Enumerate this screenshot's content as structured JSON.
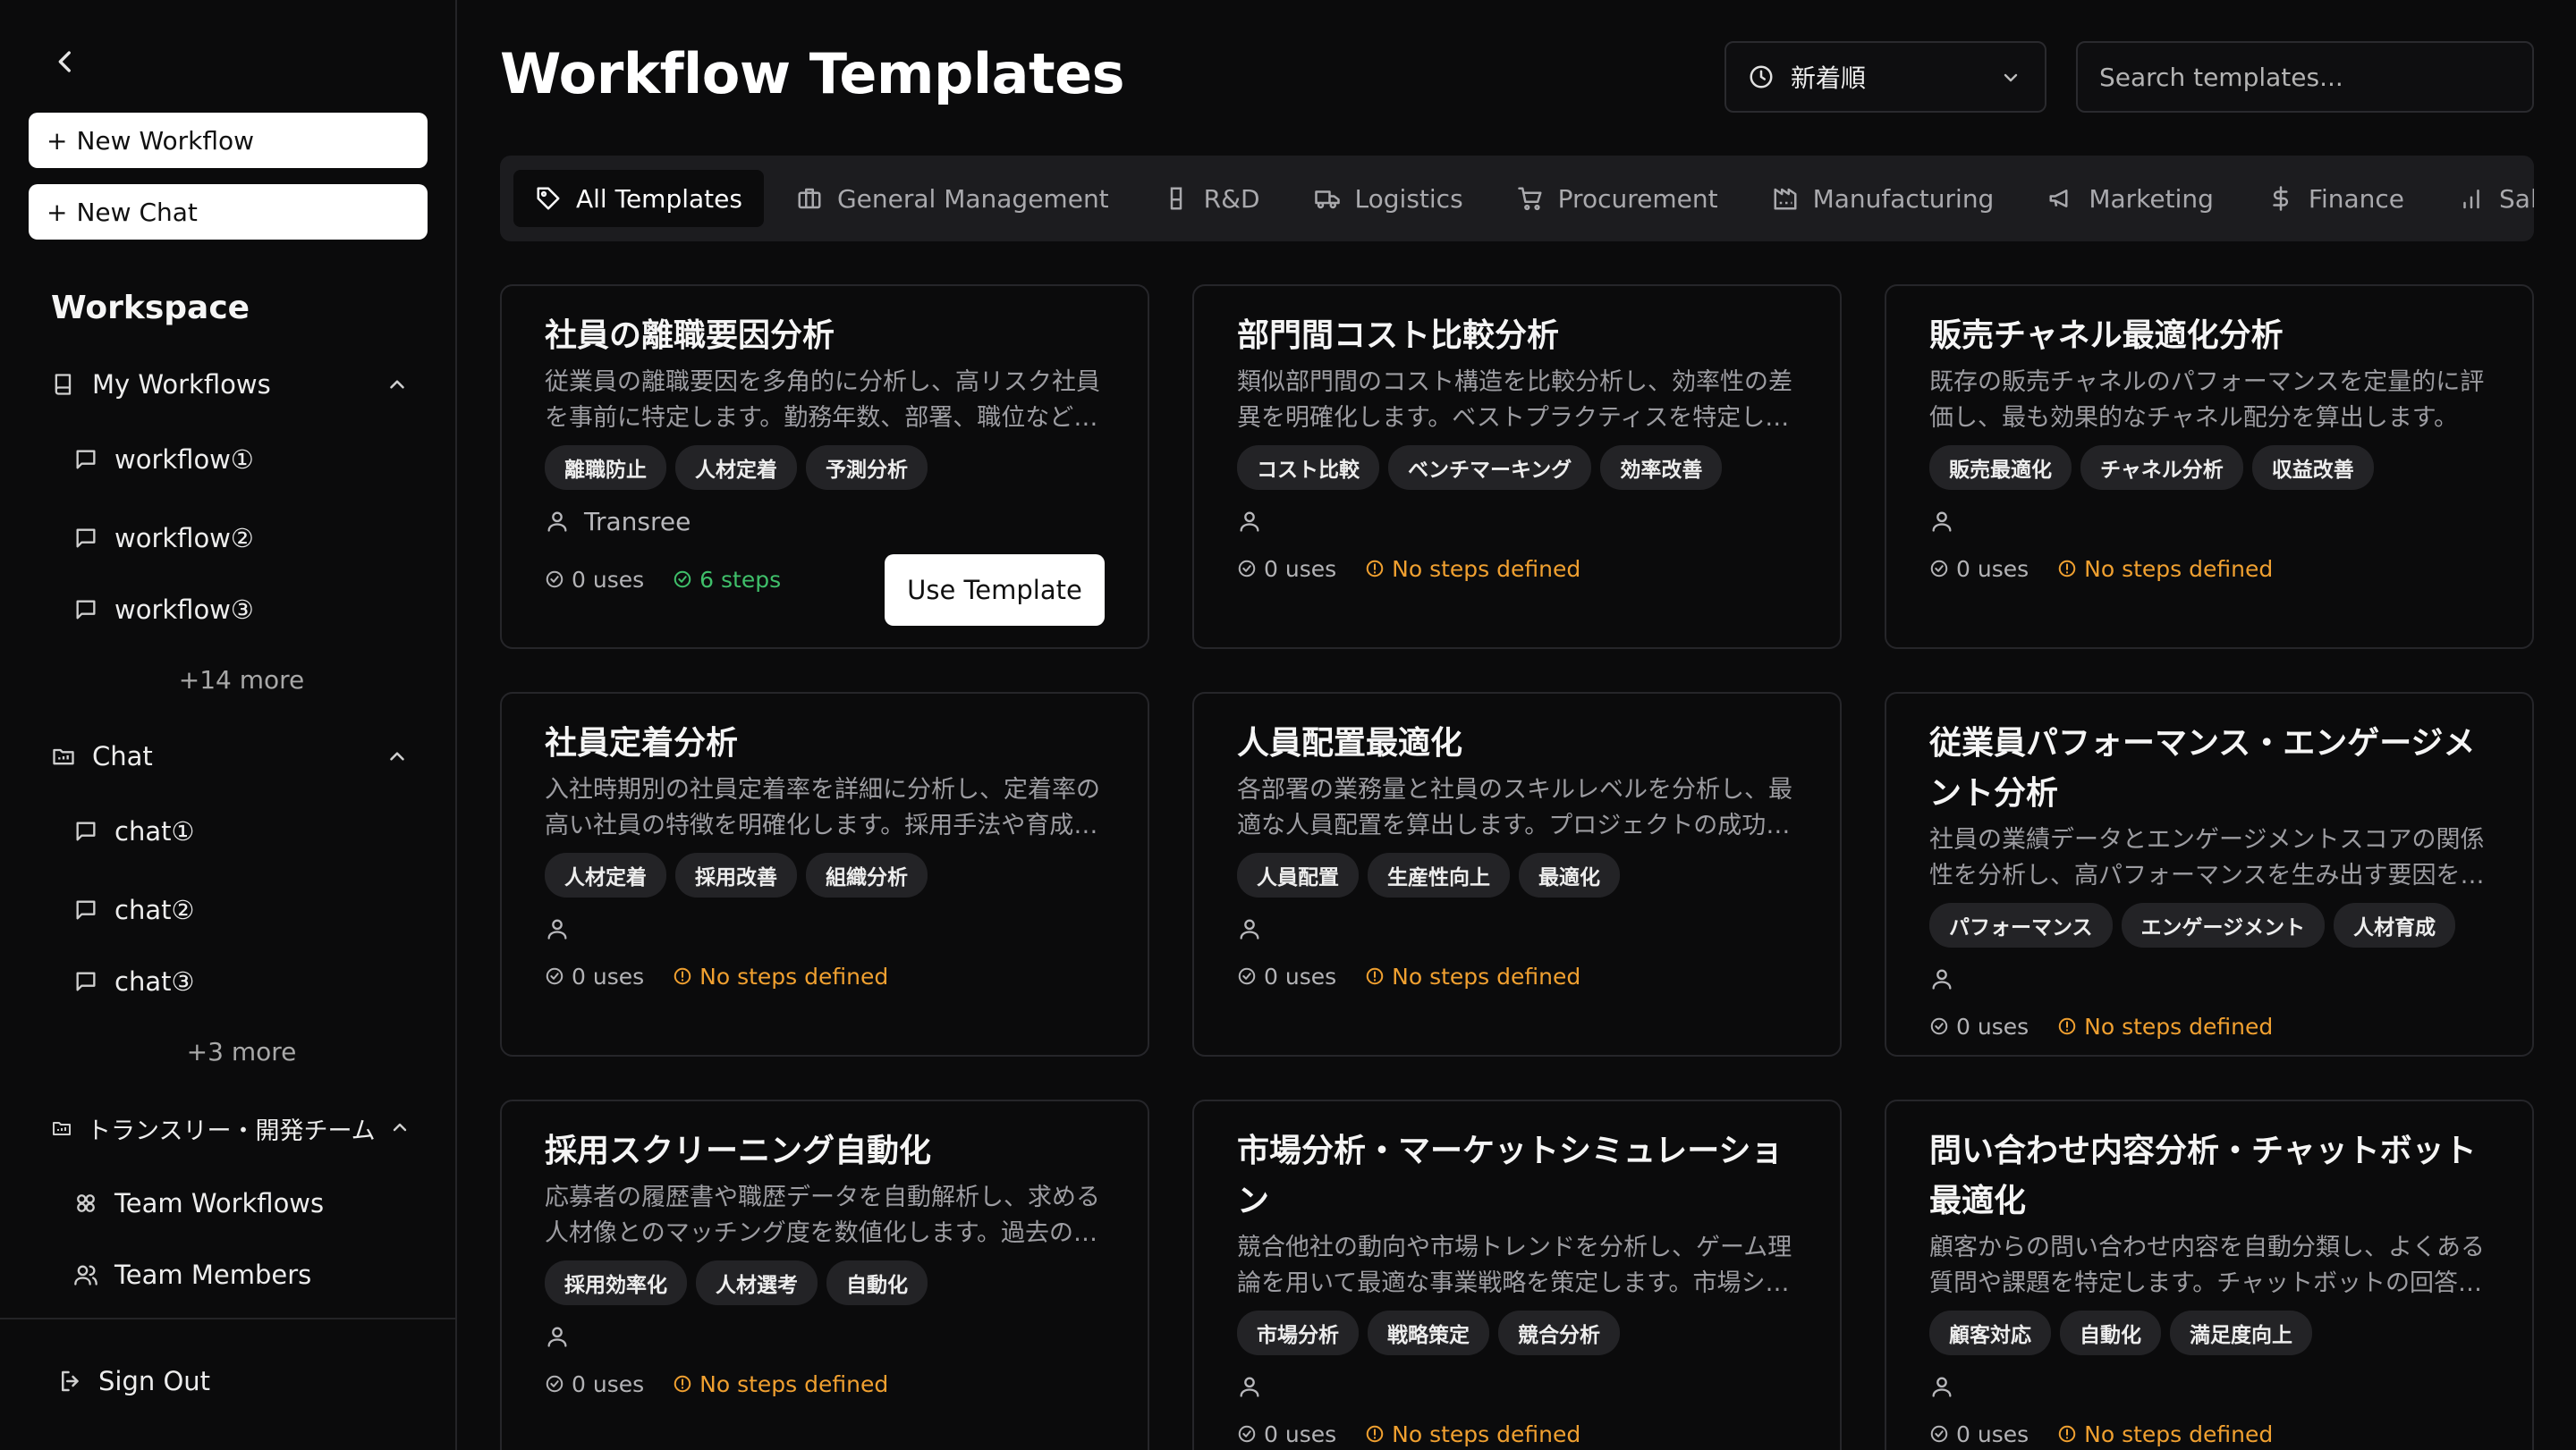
{
  "sidebar": {
    "new_workflow": "New Workflow",
    "new_chat": "New Chat",
    "workspace_title": "Workspace",
    "my_workflows": {
      "label": "My Workflows",
      "items": [
        "workflow①",
        "workflow②",
        "workflow③"
      ],
      "more": "+14 more"
    },
    "chat": {
      "label": "Chat",
      "items": [
        "chat①",
        "chat②",
        "chat③"
      ],
      "more": "+3 more"
    },
    "team": {
      "label": "トランスリー・開発チーム",
      "items": [
        "Team Workflows",
        "Team Members"
      ]
    },
    "sign_out": "Sign Out"
  },
  "header": {
    "title": "Workflow Templates",
    "sort_label": "新着順",
    "search_placeholder": "Search templates..."
  },
  "tabs": [
    {
      "label": "All Templates",
      "icon": "tag-icon"
    },
    {
      "label": "General Management",
      "icon": "briefcase-icon"
    },
    {
      "label": "R&D",
      "icon": "flask-icon"
    },
    {
      "label": "Logistics",
      "icon": "truck-icon"
    },
    {
      "label": "Procurement",
      "icon": "cart-icon"
    },
    {
      "label": "Manufacturing",
      "icon": "factory-icon"
    },
    {
      "label": "Marketing",
      "icon": "megaphone-icon"
    },
    {
      "label": "Finance",
      "icon": "dollar-icon"
    },
    {
      "label": "Sales",
      "icon": "bar-chart-icon"
    }
  ],
  "cards": [
    {
      "title": "社員の離職要因分析",
      "desc": "従業員の離職要因を多角的に分析し、高リスク社員を事前に特定します。勤務年数、部署、職位などのデータから離職傾向を予測します。",
      "tags": [
        "離職防止",
        "人材定着",
        "予測分析"
      ],
      "author": "Transree",
      "uses": "0 uses",
      "steps": "6 steps",
      "button": "Use Template"
    },
    {
      "title": "部門間コスト比較分析",
      "desc": "類似部門間のコスト構造を比較分析し、効率性の差異を明確化します。ベストプラクティスを特定します。",
      "tags": [
        "コスト比較",
        "ベンチマーキング",
        "効率改善"
      ],
      "author": "",
      "uses": "0 uses",
      "steps": "No steps defined"
    },
    {
      "title": "販売チャネル最適化分析",
      "desc": "既存の販売チャネルのパフォーマンスを定量的に評価し、最も効果的なチャネル配分を算出します。",
      "tags": [
        "販売最適化",
        "チャネル分析",
        "収益改善"
      ],
      "author": "",
      "uses": "0 uses",
      "steps": "No steps defined"
    },
    {
      "title": "社員定着分析",
      "desc": "入社時期別の社員定着率を詳細に分析し、定着率の高い社員の特徴を明確化します。採用手法や育成施策の改善に活用します。",
      "tags": [
        "人材定着",
        "採用改善",
        "組織分析"
      ],
      "author": "",
      "uses": "0 uses",
      "steps": "No steps defined"
    },
    {
      "title": "人員配置最適化",
      "desc": "各部署の業務量と社員のスキルレベルを分析し、最適な人員配置を算出します。プロジェクトの成功率を高めます。",
      "tags": [
        "人員配置",
        "生産性向上",
        "最適化"
      ],
      "author": "",
      "uses": "0 uses",
      "steps": "No steps defined"
    },
    {
      "title": "従業員パフォーマンス・エンゲージメント分析",
      "desc": "社員の業績データとエンゲージメントスコアの関係性を分析し、高パフォーマンスを生み出す要因を特定します。",
      "tags": [
        "パフォーマンス",
        "エンゲージメント",
        "人材育成"
      ],
      "author": "",
      "uses": "0 uses",
      "steps": "No steps defined"
    },
    {
      "title": "採用スクリーニング自動化",
      "desc": "応募者の履歴書や職歴データを自動解析し、求める人材像とのマッチング度を数値化します。過去の採用実績を学習します。",
      "tags": [
        "採用効率化",
        "人材選考",
        "自動化"
      ],
      "author": "",
      "uses": "0 uses",
      "steps": "No steps defined"
    },
    {
      "title": "市場分析・マーケットシミュレーション",
      "desc": "競合他社の動向や市場トレンドを分析し、ゲーム理論を用いて最適な事業戦略を策定します。市場シェアを予測します。",
      "tags": [
        "市場分析",
        "戦略策定",
        "競合分析"
      ],
      "author": "",
      "uses": "0 uses",
      "steps": "No steps defined"
    },
    {
      "title": "問い合わせ内容分析・チャットボット最適化",
      "desc": "顧客からの問い合わせ内容を自動分類し、よくある質問や課題を特定します。チャットボットの回答精度を高めます。",
      "tags": [
        "顧客対応",
        "自動化",
        "満足度向上"
      ],
      "author": "",
      "uses": "0 uses",
      "steps": "No steps defined"
    }
  ]
}
